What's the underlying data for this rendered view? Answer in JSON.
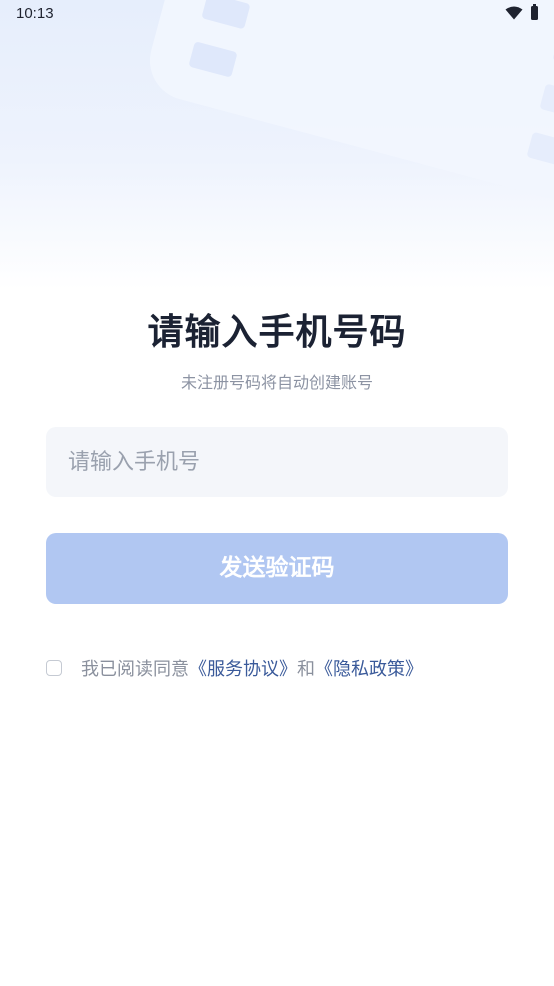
{
  "status_bar": {
    "time": "10:13",
    "icons": [
      "wifi-icon",
      "battery-icon"
    ]
  },
  "header": {
    "title": "请输入手机号码",
    "subtitle": "未注册号码将自动创建账号"
  },
  "form": {
    "phone_placeholder": "请输入手机号",
    "phone_value": "",
    "send_button_label": "发送验证码",
    "send_button_color": "#b1c7f2"
  },
  "agreement": {
    "checked": false,
    "prefix": "我已阅读同意",
    "service_link": "《服务协议》",
    "conjunction": "和",
    "privacy_link": "《隐私政策》"
  },
  "colors": {
    "link": "#3a5a9a",
    "title": "#1b2233",
    "muted": "#8c93a3"
  }
}
